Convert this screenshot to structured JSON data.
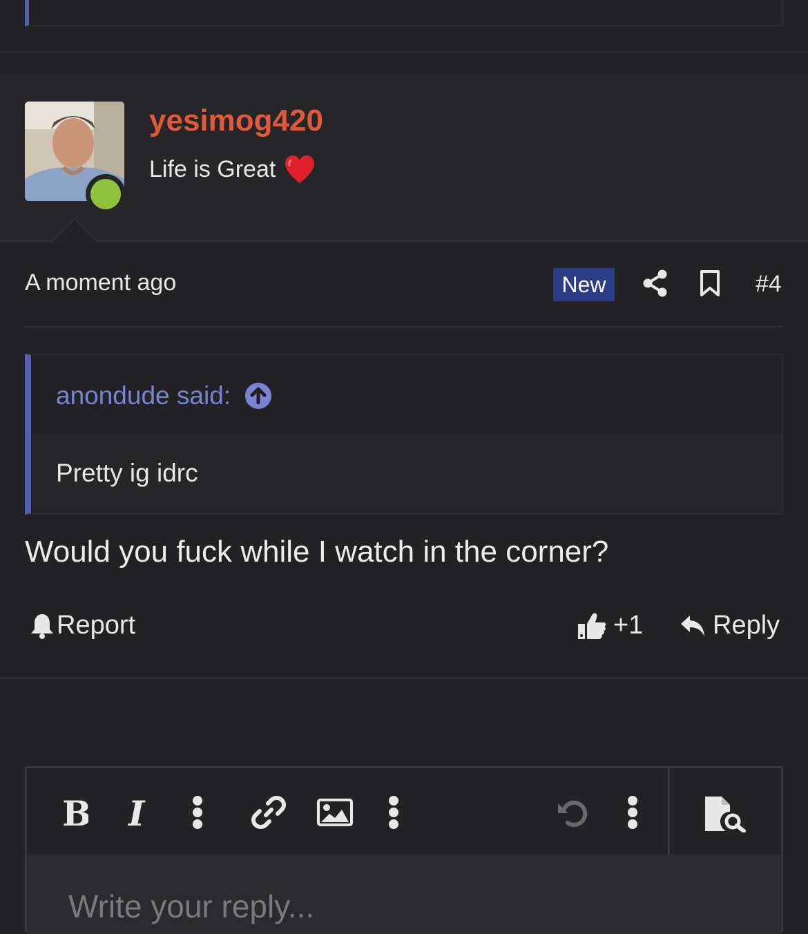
{
  "post": {
    "username": "yesimog420",
    "user_title": "Life is Great",
    "timestamp": "A moment ago",
    "badge": "New",
    "post_number": "#4",
    "quote": {
      "author": "anondude said:",
      "text": "Pretty ig idrc"
    },
    "message": "Would you fuck while I watch in the corner?",
    "actions": {
      "report_label": "Report",
      "like_count": "+1",
      "reply_label": "Reply"
    }
  },
  "editor": {
    "placeholder": "Write your reply..."
  },
  "colors": {
    "background": "#222224",
    "username": "#e05a3a",
    "quote_accent": "#5660b0",
    "quote_author": "#7b83d4",
    "badge_bg": "#2a3d86",
    "online": "#8fc33d"
  },
  "icons": [
    "heart-emoji",
    "online-indicator",
    "share-icon",
    "bookmark-icon",
    "arrow-up-circle-icon",
    "bell-icon",
    "thumbs-up-icon",
    "reply-arrow-icon",
    "bold-icon",
    "italic-icon",
    "more-vertical-icon",
    "link-icon",
    "image-icon",
    "undo-icon",
    "preview-icon"
  ]
}
